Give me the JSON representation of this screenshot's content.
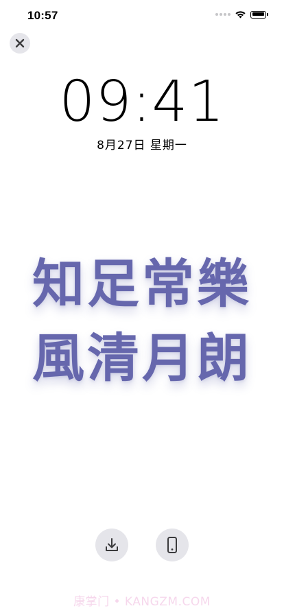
{
  "status_bar": {
    "time": "10:57",
    "icons": [
      "signal-dots-icon",
      "wifi-icon",
      "battery-icon"
    ]
  },
  "close_icon": "close-icon",
  "lock_screen": {
    "time": "09:41",
    "date": "8月27日  星期一"
  },
  "wallpaper": {
    "line1": "知足常樂",
    "line2": "風清月朗",
    "color": "#6667ad"
  },
  "actions": {
    "download_icon": "download-icon",
    "device_icon": "phone-icon"
  },
  "watermark": "康掌门 • KANGZM.COM"
}
